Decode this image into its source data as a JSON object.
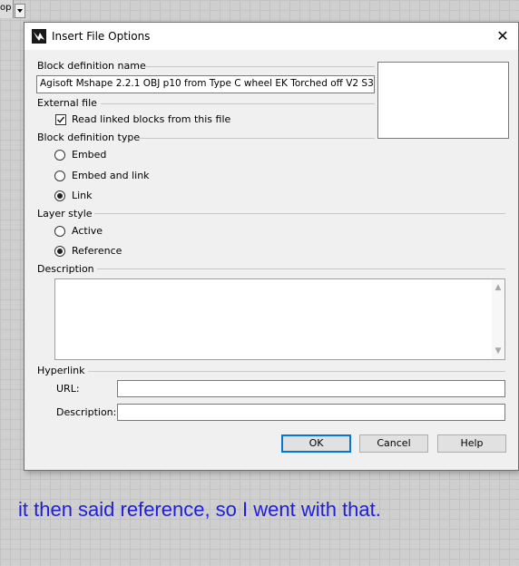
{
  "background": {
    "toolbar_fragment_text": "op"
  },
  "dialog": {
    "title": "Insert File Options",
    "close_glyph": "✕",
    "block_definition_name": {
      "label": "Block definition name",
      "value": "Agisoft Mshape 2.2.1 OBJ p10 from Type C wheel EK Torched off  V2 S3"
    },
    "external_file": {
      "label": "External file",
      "read_linked_blocks": {
        "label": "Read linked blocks from this file",
        "checked": true
      }
    },
    "block_definition_type": {
      "label": "Block definition type",
      "options": [
        {
          "label": "Embed",
          "selected": false
        },
        {
          "label": "Embed and link",
          "selected": false
        },
        {
          "label": "Link",
          "selected": true
        }
      ]
    },
    "layer_style": {
      "label": "Layer style",
      "options": [
        {
          "label": "Active",
          "selected": false
        },
        {
          "label": "Reference",
          "selected": true
        }
      ]
    },
    "description": {
      "label": "Description",
      "value": ""
    },
    "hyperlink": {
      "label": "Hyperlink",
      "url_label": "URL:",
      "url_value": "",
      "description_label": "Description:",
      "description_value": ""
    },
    "buttons": {
      "ok": "OK",
      "cancel": "Cancel",
      "help": "Help"
    }
  },
  "caption": "it then said reference, so I went with that.",
  "colors": {
    "caption_text": "#1f1fd6",
    "default_button_border": "#0078d7",
    "dialog_background": "#f0f0f0"
  }
}
